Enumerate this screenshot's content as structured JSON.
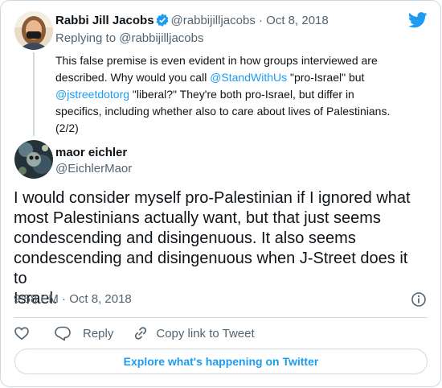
{
  "parent_tweet": {
    "author_name": "Rabbi Jill Jacobs",
    "handle": "@rabbijilljacobs",
    "separator": "·",
    "date": "Oct 8, 2018",
    "replying_to_prefix": "Replying to",
    "replying_to_handle": "@rabbijilljacobs",
    "text_line1": "This false premise is even evident in how groups interviewed are",
    "text_line2_pre": "described. Why would you call ",
    "text_line2_mention": "@StandWithUs",
    "text_line2_post": " \"pro-Israel\" but",
    "text_line3_mention": "@jstreetdotorg",
    "text_line3_post": " \"liberal?\" They're both pro-Israel, but differ in",
    "text_line4": "specifics, including whether also to care about lives of Palestinians.",
    "text_line5": "(2/2)"
  },
  "main_tweet": {
    "author_name": "maor eichler",
    "handle": "@EichlerMaor",
    "text_lines": [
      "I would consider myself pro-Palestinian if I ignored what",
      "most Palestinians actually want, but that just seems",
      "condescending and disingenuous. It also seems",
      "condescending and disingenuous when J-Street does it to",
      "Israel."
    ],
    "time": "9:58 PM",
    "separator": "·",
    "date": "Oct 8, 2018"
  },
  "actions": {
    "like_icon": "heart-icon",
    "reply_label": "Reply",
    "copy_label": "Copy link to Tweet"
  },
  "explore_label": "Explore what's happening on Twitter",
  "colors": {
    "accent": "#1d9bf0",
    "text": "#0f1419",
    "muted": "#536471",
    "border": "#cfd9de"
  }
}
